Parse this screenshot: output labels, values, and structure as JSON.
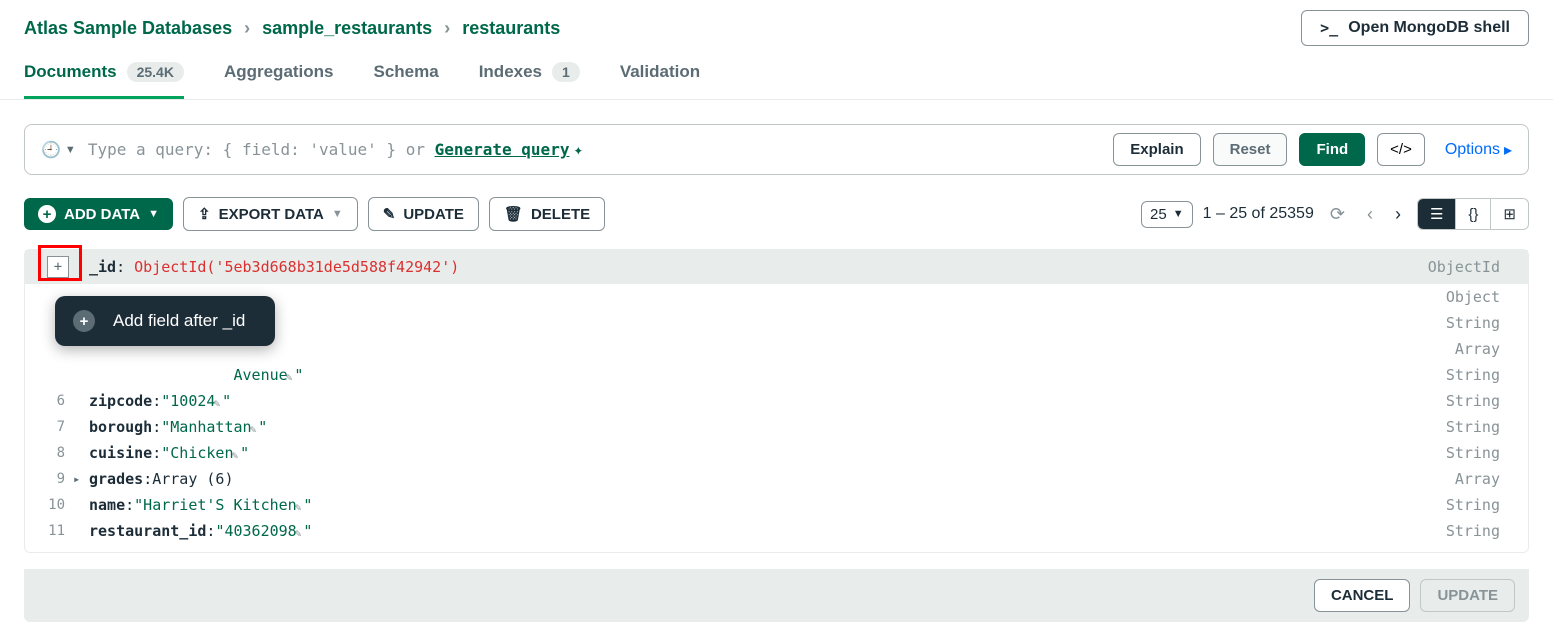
{
  "breadcrumb": [
    "Atlas Sample Databases",
    "sample_restaurants",
    "restaurants"
  ],
  "shell_button": "Open MongoDB shell",
  "tabs": [
    {
      "label": "Documents",
      "badge": "25.4K",
      "active": true
    },
    {
      "label": "Aggregations"
    },
    {
      "label": "Schema"
    },
    {
      "label": "Indexes",
      "badge": "1"
    },
    {
      "label": "Validation"
    }
  ],
  "query": {
    "placeholder_prefix": "Type a query: { field: 'value' } or ",
    "generate": "Generate query",
    "explain": "Explain",
    "reset": "Reset",
    "find": "Find",
    "options": "Options"
  },
  "toolbar": {
    "add": "ADD DATA",
    "export": "EXPORT DATA",
    "update": "UPDATE",
    "delete": "DELETE",
    "page_size": "25",
    "page_range": "1 – 25 of 25359"
  },
  "popup": {
    "label": "Add field after _id"
  },
  "document": {
    "rows": [
      {
        "line": "",
        "key": "_id",
        "value": "ObjectId('5eb3d668b31de5d588f42942')",
        "value_class": "val-red",
        "type": "ObjectId",
        "header": true,
        "indent": 0
      },
      {
        "line": "",
        "type": "Object"
      },
      {
        "line": "",
        "type": "String"
      },
      {
        "line": "",
        "type": "Array"
      },
      {
        "line": "",
        "key": "",
        "value_prefix": "Avenue",
        "pencil": true,
        "value_suffix": "\"",
        "type": "String",
        "indent": 2,
        "text_only": true
      },
      {
        "line": "6",
        "key": "zipcode",
        "value": "\"10024",
        "pencil": true,
        "value_suffix": "\"",
        "value_class": "val-green",
        "type": "String",
        "indent": 2
      },
      {
        "line": "7",
        "key": "borough",
        "value": "\"Manhattan",
        "pencil": true,
        "value_suffix": "\"",
        "value_class": "val-green",
        "type": "String",
        "indent": 1
      },
      {
        "line": "8",
        "key": "cuisine",
        "value": "\"Chicken",
        "pencil": true,
        "value_suffix": "\"",
        "value_class": "val-green",
        "type": "String",
        "indent": 1
      },
      {
        "line": "9",
        "key": "grades",
        "value": "Array (6)",
        "value_class": "",
        "type": "Array",
        "indent": 1,
        "expander": true
      },
      {
        "line": "10",
        "key": "name",
        "value": "\"Harriet'S Kitchen",
        "pencil": true,
        "value_suffix": "\"",
        "value_class": "val-green",
        "type": "String",
        "indent": 1
      },
      {
        "line": "11",
        "key": "restaurant_id",
        "value": "\"40362098",
        "pencil": true,
        "value_suffix": "\"",
        "value_class": "val-green",
        "type": "String",
        "indent": 1
      }
    ]
  },
  "footer": {
    "cancel": "CANCEL",
    "update": "UPDATE"
  }
}
